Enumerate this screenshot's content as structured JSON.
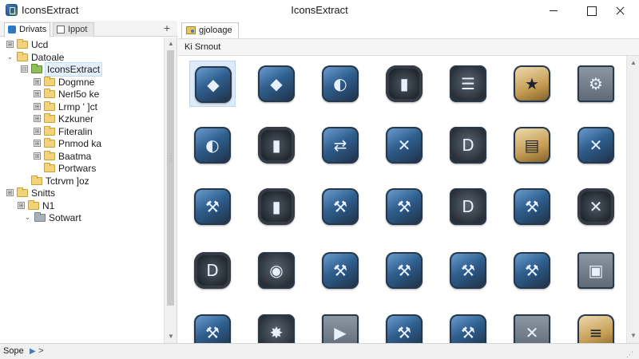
{
  "window": {
    "title_left": "IconsExtract",
    "title_center": "IconsExtract"
  },
  "left_pane": {
    "tabs": [
      {
        "label": "Drivats"
      },
      {
        "label": "Ippot"
      }
    ],
    "add_tab_symbol": "+",
    "tree": [
      {
        "label": "Ucd",
        "icon": "folder",
        "expander": "box",
        "expander_symbol": "⊞"
      },
      {
        "label": "Datoale",
        "icon": "folder",
        "expander": "arrow",
        "expander_symbol": "⌄"
      },
      {
        "label": "IconsExtract",
        "icon": "app-folder",
        "expander": "box",
        "expander_symbol": "⊟"
      },
      {
        "label": "Dogmne",
        "icon": "folder",
        "expander": "box",
        "expander_symbol": "⊞"
      },
      {
        "label": "Nerl5o ke",
        "icon": "folder",
        "expander": "box",
        "expander_symbol": "⊞"
      },
      {
        "label": "Lrmp ' ]ct",
        "icon": "folder",
        "expander": "box",
        "expander_symbol": "⊞"
      },
      {
        "label": "Kzkuner",
        "icon": "folder",
        "expander": "box",
        "expander_symbol": "⊞"
      },
      {
        "label": "Fiteralin",
        "icon": "folder",
        "expander": "box",
        "expander_symbol": "⊞"
      },
      {
        "label": "Pnmod ka",
        "icon": "folder",
        "expander": "box",
        "expander_symbol": "⊞"
      },
      {
        "label": "Baatma",
        "icon": "folder",
        "expander": "box",
        "expander_symbol": "⊞"
      },
      {
        "label": "Portwars",
        "icon": "folder",
        "expander": "none",
        "expander_symbol": ""
      },
      {
        "label": "Tctrvm ]oz",
        "icon": "folder",
        "expander": "none",
        "expander_symbol": ""
      },
      {
        "label": "Snitts",
        "icon": "folder",
        "expander": "box",
        "expander_symbol": "⊞"
      },
      {
        "label": "N1",
        "icon": "folder",
        "expander": "box",
        "expander_symbol": "⊞"
      },
      {
        "label": "Sotwart",
        "icon": "gray-folder",
        "expander": "arrow",
        "expander_symbol": "⌄"
      }
    ]
  },
  "right_pane": {
    "tab_label": "gjoloage",
    "header": "Ki Srnout",
    "icons": [
      {
        "name": "shield-icon",
        "style": "blue",
        "glyph": "◆"
      },
      {
        "name": "blue-shield-icon",
        "style": "blue",
        "glyph": "◆"
      },
      {
        "name": "helmet-icon",
        "style": "blue",
        "glyph": "◐"
      },
      {
        "name": "gear-panel-icon",
        "style": "gear",
        "glyph": "▮"
      },
      {
        "name": "barrel-icon",
        "style": "dark",
        "glyph": "☰"
      },
      {
        "name": "star-badge-icon",
        "style": "brown",
        "glyph": "★"
      },
      {
        "name": "film-cog-icon",
        "style": "flat",
        "glyph": "⚙"
      },
      {
        "name": "helmet-blue-icon",
        "style": "blue",
        "glyph": "◐"
      },
      {
        "name": "gear-shield-icon",
        "style": "gear",
        "glyph": "▮"
      },
      {
        "name": "media-arrow-icon",
        "style": "blue",
        "glyph": "⇄"
      },
      {
        "name": "tools-cross-icon",
        "style": "blue",
        "glyph": "✕"
      },
      {
        "name": "play-d-icon",
        "style": "dark",
        "glyph": "D"
      },
      {
        "name": "document-icon",
        "style": "brown",
        "glyph": "▤"
      },
      {
        "name": "tools-icon",
        "style": "blue",
        "glyph": "✕"
      },
      {
        "name": "wrench-icon",
        "style": "blue",
        "glyph": "⚒"
      },
      {
        "name": "gear-doc-icon",
        "style": "gear",
        "glyph": "▮"
      },
      {
        "name": "wrench-blue-icon",
        "style": "blue",
        "glyph": "⚒"
      },
      {
        "name": "wrench-dark-icon",
        "style": "blue",
        "glyph": "⚒"
      },
      {
        "name": "d-frame-icon",
        "style": "dark",
        "glyph": "D"
      },
      {
        "name": "wrench-shield-icon",
        "style": "blue",
        "glyph": "⚒"
      },
      {
        "name": "gear-tools-icon",
        "style": "gear",
        "glyph": "✕"
      },
      {
        "name": "gear-d-icon",
        "style": "gear",
        "glyph": "D"
      },
      {
        "name": "camera-lens-icon",
        "style": "dark",
        "glyph": "◉"
      },
      {
        "name": "wrench-glass-icon",
        "style": "blue",
        "glyph": "⚒"
      },
      {
        "name": "wrench-tile-icon",
        "style": "blue",
        "glyph": "⚒"
      },
      {
        "name": "wrench-gear-icon",
        "style": "blue",
        "glyph": "⚒"
      },
      {
        "name": "shield-wrench-icon",
        "style": "blue",
        "glyph": "⚒"
      },
      {
        "name": "cube-icon",
        "style": "flat",
        "glyph": "▣"
      },
      {
        "name": "wrench-panel-icon",
        "style": "blue",
        "glyph": "⚒"
      },
      {
        "name": "star-burst-icon",
        "style": "dark",
        "glyph": "✸"
      },
      {
        "name": "film-camera-icon",
        "style": "flat",
        "glyph": "▶"
      },
      {
        "name": "wrench-film-icon",
        "style": "blue",
        "glyph": "⚒"
      },
      {
        "name": "wrench-clip-icon",
        "style": "blue",
        "glyph": "⚒"
      },
      {
        "name": "x-frame-icon",
        "style": "flat",
        "glyph": "✕"
      },
      {
        "name": "layers-icon",
        "style": "brown",
        "glyph": "≡"
      }
    ]
  },
  "statusbar": {
    "text": "Sope",
    "arrow": ">"
  },
  "colors": {
    "selection": "#dcebf9",
    "folder": "#f2d27a",
    "accent": "#3a7fc4"
  }
}
